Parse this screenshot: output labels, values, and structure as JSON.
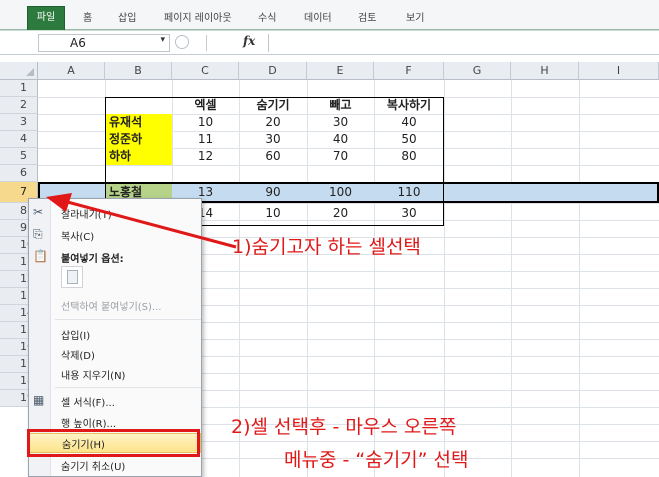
{
  "ribbon": {
    "tabs": [
      {
        "label": "파일"
      },
      {
        "label": "홈"
      },
      {
        "label": "삽입"
      },
      {
        "label": "페이지 레이아웃"
      },
      {
        "label": "수식"
      },
      {
        "label": "데이터"
      },
      {
        "label": "검토"
      },
      {
        "label": "보기"
      }
    ]
  },
  "formula_bar": {
    "name_box": "A6",
    "fx_symbol": "fx",
    "value": ""
  },
  "grid": {
    "columns": [
      "A",
      "B",
      "C",
      "D",
      "E",
      "F",
      "G",
      "H",
      "I"
    ],
    "rows": [
      "1",
      "2",
      "3",
      "4",
      "5",
      "6",
      "7",
      "8",
      "9",
      "10",
      "11",
      "12",
      "13",
      "14",
      "15",
      "16",
      "17",
      "18",
      "19"
    ],
    "headers": [
      "엑셀",
      "숨기기",
      "빼고",
      "복사하기"
    ],
    "data_rows": [
      {
        "name": "유재석",
        "values": [
          "10",
          "20",
          "30",
          "40"
        ]
      },
      {
        "name": "정준하",
        "values": [
          "11",
          "30",
          "40",
          "50"
        ]
      },
      {
        "name": "하하",
        "values": [
          "12",
          "60",
          "70",
          "80"
        ]
      },
      {
        "name": "노홍철",
        "values": [
          "13",
          "90",
          "100",
          "110"
        ]
      },
      {
        "name": "",
        "values": [
          "14",
          "10",
          "20",
          "30"
        ]
      }
    ]
  },
  "context_menu": {
    "cut": "잘라내기(T)",
    "copy": "복사(C)",
    "paste_options": "붙여넣기 옵션:",
    "paste_special": "선택하여 붙여넣기(S)...",
    "insert": "삽입(I)",
    "delete": "삭제(D)",
    "clear_contents": "내용 지우기(N)",
    "format_cells": "셀 서식(F)...",
    "row_height": "행 높이(R)...",
    "hide": "숨기기(H)",
    "unhide": "숨기기 취소(U)"
  },
  "annotations": {
    "step1": "1)숨기고자 하는 셀선택",
    "step2_line1": "2)셀 선택후 - 마우스 오른쪽",
    "step2_line2": "메뉴중 - “숨기기” 선택",
    "color": "#e01818"
  },
  "colors": {
    "file_tab": "#2c7a3e",
    "highlight_yellow": "#ffff00",
    "row_selection": "#c5dcf0",
    "menu_highlight": "#fde38a"
  }
}
